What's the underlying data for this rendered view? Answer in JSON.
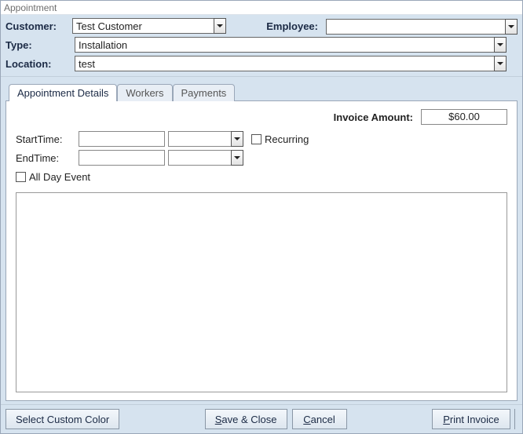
{
  "window": {
    "title": "Appointment"
  },
  "header": {
    "customer_label": "Customer:",
    "customer_value": "Test Customer",
    "employee_label": "Employee:",
    "employee_value": "",
    "type_label": "Type:",
    "type_value": "Installation",
    "location_label": "Location:",
    "location_value": "test"
  },
  "tabs": {
    "details": "Appointment Details",
    "workers": "Workers",
    "payments": "Payments"
  },
  "details": {
    "invoice_label": "Invoice Amount:",
    "invoice_value": "$60.00",
    "start_label": "StartTime:",
    "start_date": "",
    "start_time": "",
    "end_label": "EndTime:",
    "end_date": "",
    "end_time": "",
    "recurring_label": "Recurring",
    "allday_label": "All Day Event",
    "notes": ""
  },
  "footer": {
    "custom_color": "Select Custom Color",
    "save_prefix": "S",
    "save_rest": "ave & Close",
    "cancel_prefix": "C",
    "cancel_rest": "ancel",
    "print_prefix": "P",
    "print_rest": "rint Invoice"
  }
}
